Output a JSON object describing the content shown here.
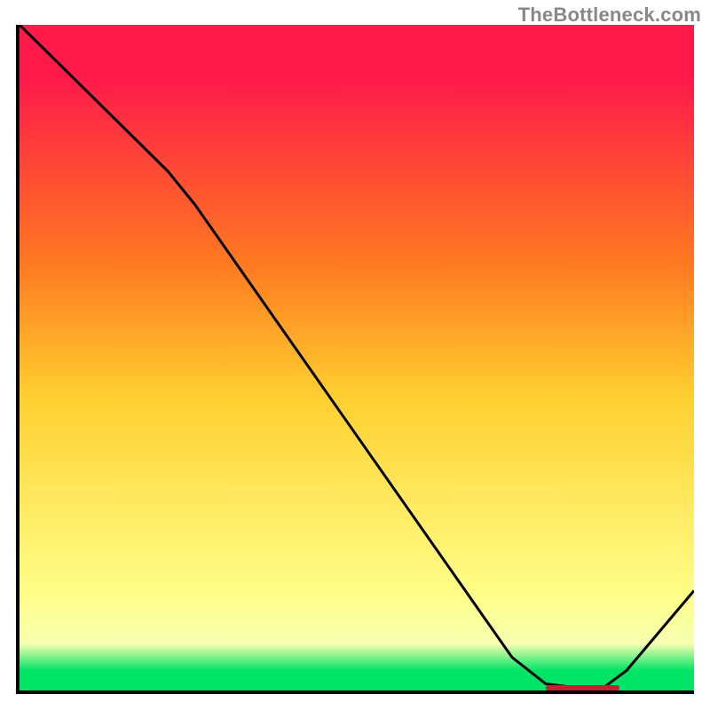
{
  "source_label": "TheBottleneck.com",
  "chart_data": {
    "type": "line",
    "title": "",
    "xlabel": "",
    "ylabel": "",
    "xlim": [
      0,
      100
    ],
    "ylim": [
      0,
      100
    ],
    "gradient_colors_bottom_to_top": [
      "#00e566",
      "#ffff8a",
      "#ffd030",
      "#ff7a20",
      "#ff1a4a"
    ],
    "x": [
      0,
      2,
      22,
      26,
      73,
      78,
      86,
      90,
      100
    ],
    "y": [
      100,
      98,
      78,
      73,
      5,
      1,
      0,
      3,
      15
    ],
    "bottom_marker": {
      "x_start": 78,
      "x_end": 89,
      "y": 0,
      "color": "#c02030"
    }
  }
}
